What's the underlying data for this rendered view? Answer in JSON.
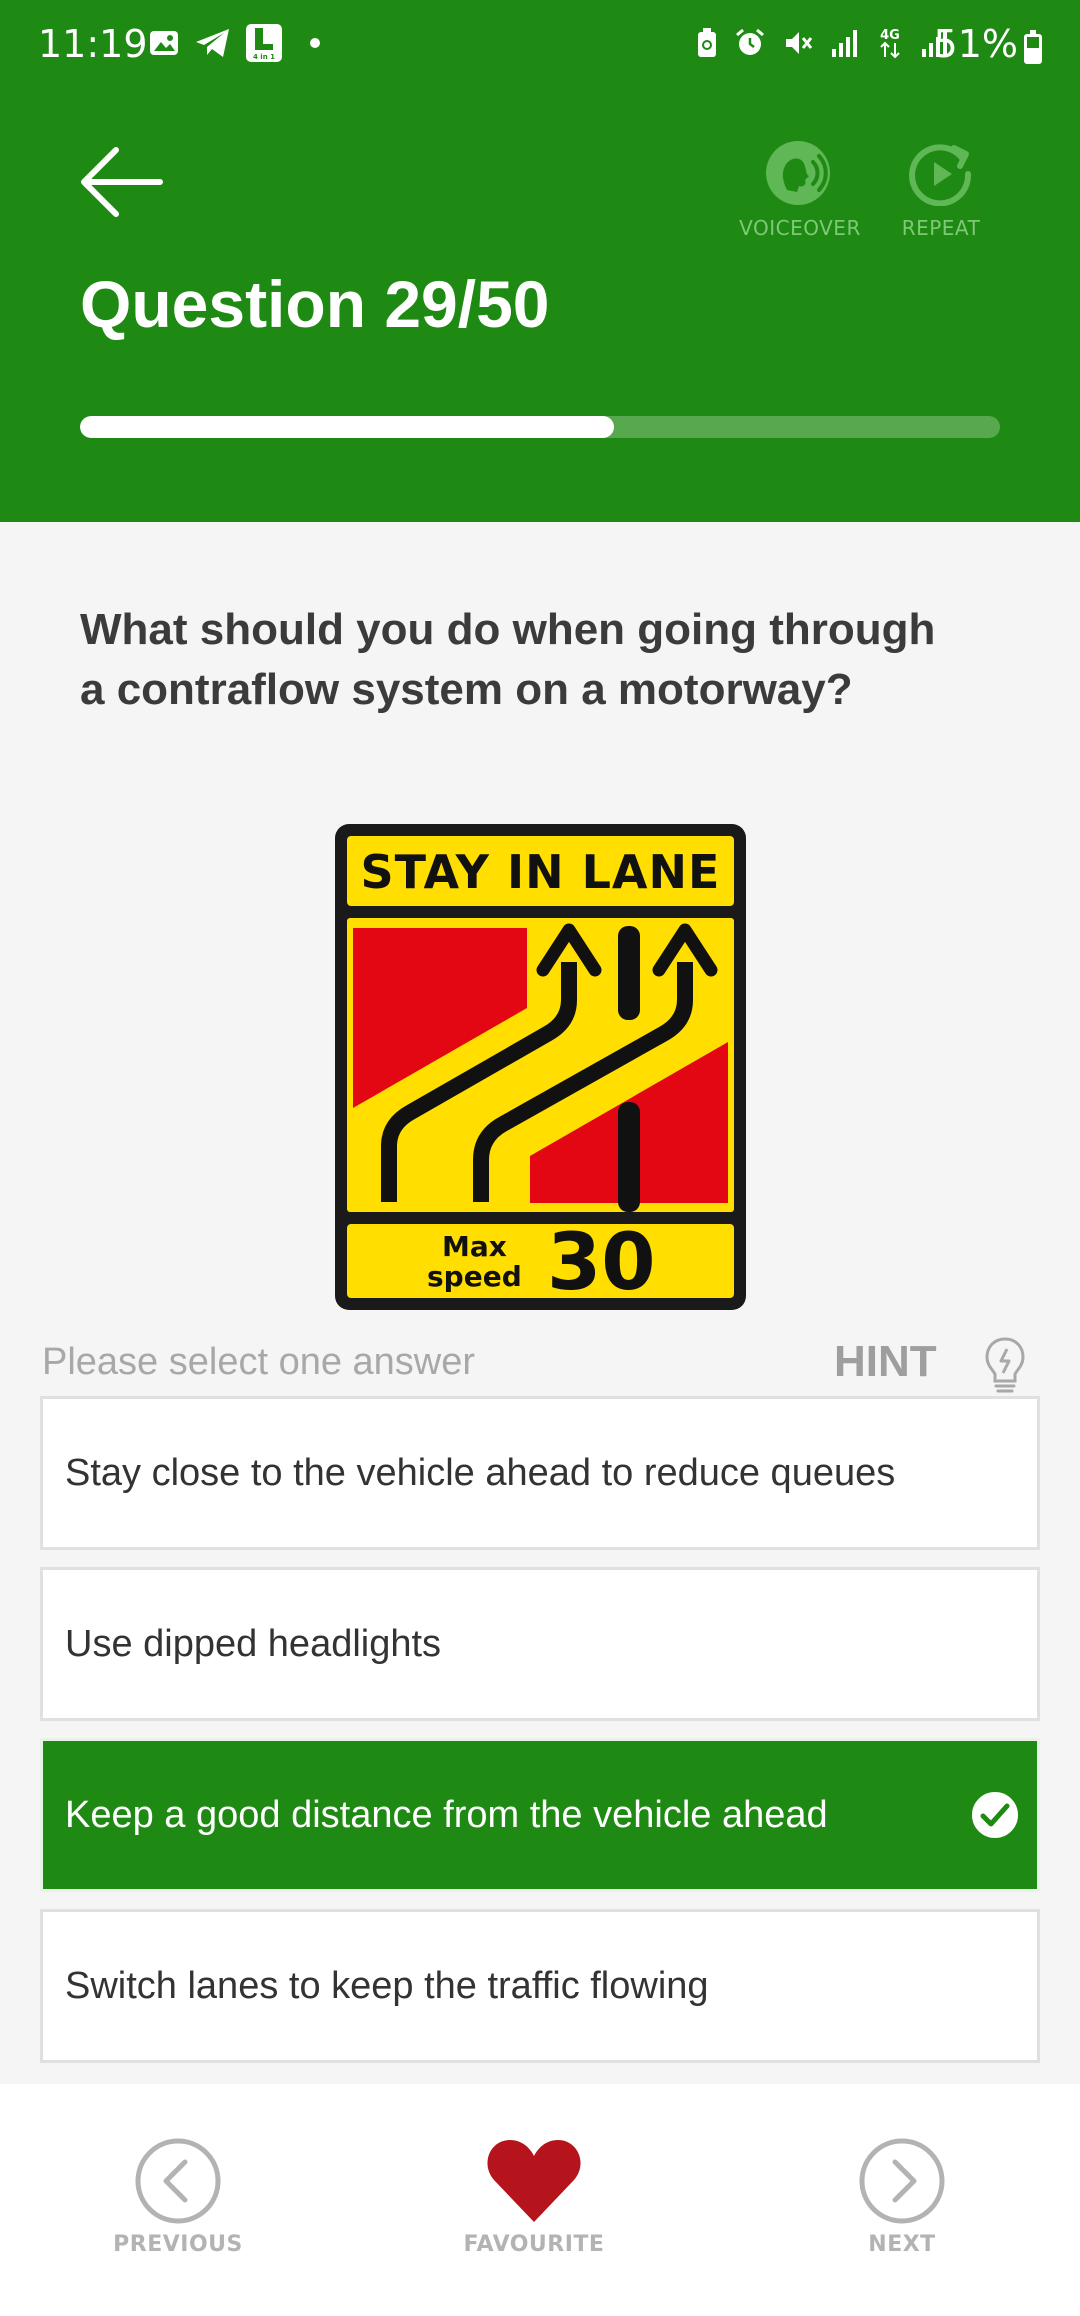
{
  "status_bar": {
    "time": "11:19",
    "battery": "51%",
    "icons": [
      "gallery-icon",
      "telegram-icon",
      "app-4in1-icon",
      "dot-icon",
      "battery-saver-icon",
      "alarm-icon",
      "mute-icon",
      "signal-icon",
      "4g-icon",
      "signal-icon-2"
    ],
    "app_icon_text": "4 in 1"
  },
  "header": {
    "back_icon": "arrow-left-icon",
    "voiceover_label": "VOICEOVER",
    "repeat_label": "REPEAT",
    "title": "Question 29/50",
    "progress_fraction": 0.58
  },
  "question": {
    "text": "What should you do when going through a contraflow system on a motorway?",
    "sign": {
      "top_text": "STAY IN LANE",
      "max_label_1": "Max",
      "max_label_2": "speed",
      "speed": "30"
    }
  },
  "answers_header": {
    "prompt": "Please select one answer",
    "hint": "HINT"
  },
  "answers": [
    {
      "text": "Stay close to the vehicle ahead to reduce queues",
      "selected": false
    },
    {
      "text": "Use dipped headlights",
      "selected": false
    },
    {
      "text": "Keep a good distance from the vehicle ahead",
      "selected": true
    },
    {
      "text": "Switch lanes to keep the traffic flowing",
      "selected": false
    }
  ],
  "bottom_nav": {
    "previous": "PREVIOUS",
    "favourite": "FAVOURITE",
    "next": "NEXT"
  },
  "colors": {
    "brand_green": "#1e8a13",
    "sign_yellow": "#ffde00",
    "sign_red": "#e30613",
    "favourite_red": "#b5141c"
  }
}
